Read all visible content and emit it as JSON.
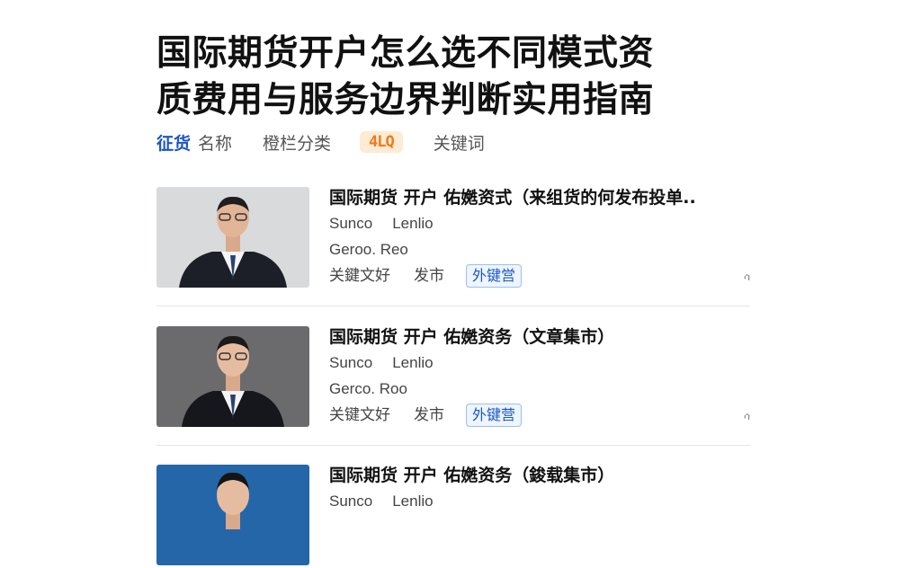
{
  "page_title": {
    "line1": "国际期货开户怎么选不同模式资",
    "line2": "质费用与服务边界判断实用指南"
  },
  "filters": {
    "active": "征货",
    "name": "名称",
    "column": "橙栏分类",
    "badge": "4LQ",
    "keyword": "关键词"
  },
  "articles": [
    {
      "title": "国际期货 开户 佑嬎资式（来组货的何发布投单..",
      "author_line1": [
        "Sunco",
        "Lenlio"
      ],
      "author_line2": "Geroo. Reo",
      "keyword": "关鍵文好",
      "publish": "发市",
      "tag": "外键営",
      "more": "ሳ",
      "thumb_bg": "#d9dadc"
    },
    {
      "title": "国际期货 开户 佑嬎资务（文章集市）",
      "author_line1": [
        "Sunco",
        "Lenlio"
      ],
      "author_line2": "Gerco. Roo",
      "keyword": "关键文好",
      "publish": "发市",
      "tag": "外键营",
      "more": "ሳ",
      "thumb_bg": "#6b6b6d"
    },
    {
      "title": "国际期货 开户 佑嬎资务（鋑载集市）",
      "author_line1": [
        "Sunco",
        "Lenlio"
      ],
      "author_line2": "",
      "keyword": "",
      "publish": "",
      "tag": "",
      "more": "",
      "thumb_bg": "#2566a8"
    }
  ],
  "colors": {
    "accent_blue": "#1a56c8",
    "badge_orange": "#f07a1a"
  }
}
